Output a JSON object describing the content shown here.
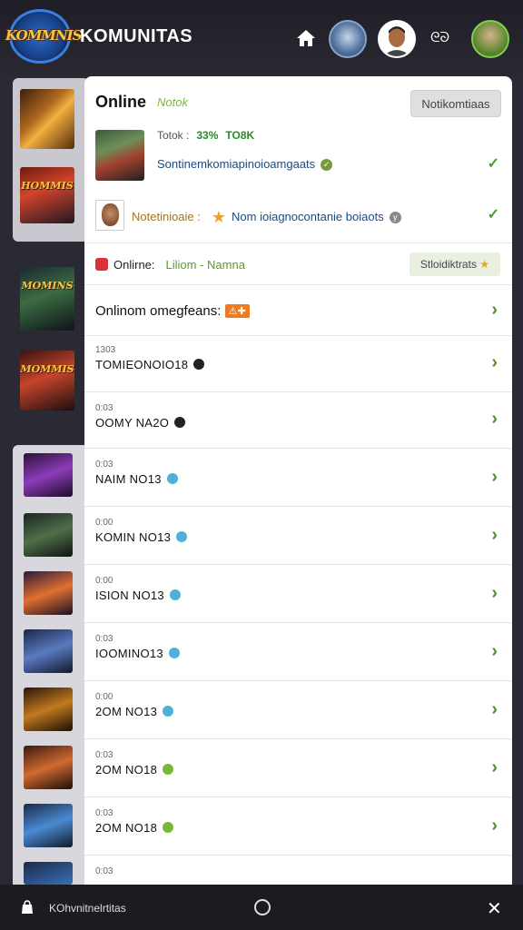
{
  "header": {
    "logo_text": "KOMMNIS",
    "title": "KOMUNITAS",
    "right_text": "ᘓᘐ"
  },
  "thumbs": {
    "mini_titles": [
      "",
      "HOMMIS",
      "MOMINS",
      "MOMMIS"
    ]
  },
  "notifications": {
    "title": "Online",
    "subtitle": "Notok",
    "button_label": "Notikomtiaas",
    "stat_label": "Totok :",
    "stat_pct": "33%",
    "stat_value": "TO8K",
    "line1": "Sontinemkomiapinoioamgaats",
    "line2_left": "Notetinioaie :",
    "line2_right": "Nom ioiagnocontanie boiaots"
  },
  "online_row": {
    "label": "Onlirne:",
    "status": "Liliom - Namna",
    "button_label": "Stloidiktrats"
  },
  "section": {
    "title": "Onlinom omegfeans:",
    "tag": "⚠✚"
  },
  "list": [
    {
      "small": "1303",
      "name": "TOMIEONOIO18",
      "dot": "dark"
    },
    {
      "small": "0:03",
      "name": "OOMY NA2O",
      "dot": "dark"
    },
    {
      "small": "0:03",
      "name": "NAIM NO13",
      "dot": "blue"
    },
    {
      "small": "0:00",
      "name": "KOMIN NO13",
      "dot": "blue"
    },
    {
      "small": "0:00",
      "name": "ISION NO13",
      "dot": "blue"
    },
    {
      "small": "0:03",
      "name": "IOOMINO13",
      "dot": "blue"
    },
    {
      "small": "0:00",
      "name": "2OM NO13",
      "dot": "blue"
    },
    {
      "small": "0:03",
      "name": "2OM NO18",
      "dot": "green"
    },
    {
      "small": "0:03",
      "name": "2OM NO18",
      "dot": "green"
    },
    {
      "small": "0:03",
      "name": "",
      "dot": "none"
    }
  ],
  "bottom_bar": {
    "label": "KOhvnitnelrtitas"
  },
  "colors": {
    "accent_green": "#5a9a2a",
    "header_bg": "#1f1d25",
    "panel_bg": "#ffffff"
  }
}
